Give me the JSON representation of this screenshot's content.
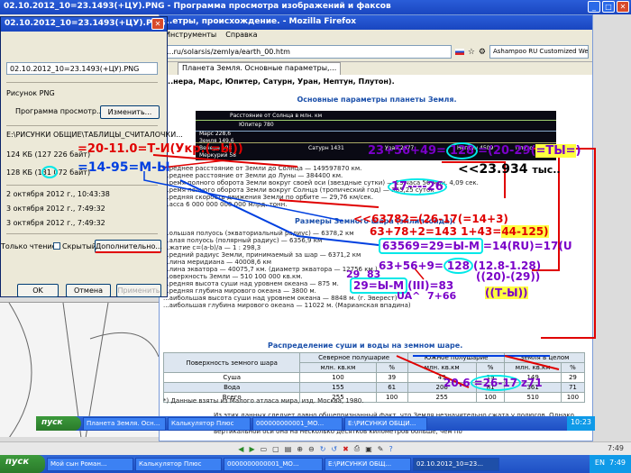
{
  "viewer": {
    "title": "02.10.2012_10=23.1493(+ЦУ).PNG - Программа просмотра изображений и факсов",
    "bottom_time": "7:49",
    "toolbar_icons": [
      "prev-icon",
      "next-icon",
      "fit-icon",
      "actual-size-icon",
      "slideshow-icon",
      "zoom-in-icon",
      "zoom-out-icon",
      "rotate-cw-icon",
      "rotate-ccw-icon",
      "delete-icon",
      "print-icon",
      "save-icon",
      "edit-icon",
      "help-icon"
    ]
  },
  "firefox": {
    "title": "...етры, происхождение. - Mozilla Firefox",
    "menu": [
      "Инструменты",
      "Справка"
    ],
    "url": "...ru/solarsis/zemlya/earth_00.htm",
    "search_placeholder": "Ashampoo RU Customized Web",
    "tab_label": "Планета Земля. Основные параметры,...",
    "page_heading": "...нера, Марс, Юпитер, Сатурн, Уран, Нептун, Плутон).",
    "section1_title": "Основные параметры планеты Земля.",
    "solar_labels": {
      "asteroids": "Расстояние от Солнца в млн. км",
      "jupiter": "Юпитер 780",
      "mars": "Марс 228,6",
      "earth": "Земля 149,6",
      "venus": "Венера 108",
      "mercury": "Меркурий 58",
      "saturn": "Сатурн 1431",
      "uranus": "Уран 2877",
      "neptune": "Нептун 4509",
      "pluto": "Плутон 5916"
    },
    "params": [
      "...реднее расстояние от Земли до Солнца — 149597870 км.",
      "...реднее расстояние от Земли до Луны — 384400 км.",
      "...ремя полного оборота Земли вокруг своей оси (звездные сутки) — 23 часа 56 мин. 4,09 сек.",
      "...ремя полного оборота Земли вокруг Солнца (тропический год) — 365,25 суток",
      "...редняя скорость движения Земли по орбите — 29,76 км/сек.",
      "...асса 6 000 000 000 000 млрд. тонн."
    ],
    "section2_title": "Размеры Земного шара (эллипсоида):",
    "sizes": [
      "...ольшая полуось (экваториальный радиус) — 6378,2 км",
      "...алая полуось (полярный радиус) — 6356,9 км",
      "...жатие c=(a-b)/a — 1 : 298,3",
      "...редний радиус Земли, принимаемый за шар — 6371,2 км",
      "...лина меридиана — 40008,6 км",
      "...лина экватора — 40075,7 км. (диаметр экватора — 12756 км.)",
      "...оверхность Земли — 510 100 000 кв.км.",
      "...редняя высота суши над уровнем океана — 875 м.",
      "...редняя глубина мирового океана — 3800 м.",
      "...аибольшая высота суши над уровнем океана — 8848 м. (г. Эверест)",
      "...аибольшая глубина мирового океана — 11022 м. (Марианская впадина)"
    ],
    "section3_title": "Распределение суши и воды на земном шаре.",
    "table": {
      "h_surface": "Поверхность земного шара",
      "h_north": "Северное полушарие",
      "h_south": "Южное полушарие",
      "h_earth": "Земля в целом",
      "h_unit": "млн. кв.км",
      "h_pct": "%",
      "rows": [
        {
          "name": "Суша",
          "n": "100",
          "np": "39",
          "s": "49",
          "sp": "19",
          "e": "149",
          "ep": "29"
        },
        {
          "name": "Вода",
          "n": "155",
          "np": "61",
          "s": "206",
          "sp": "81",
          "e": "361",
          "ep": "71"
        },
        {
          "name": "Всего",
          "n": "255",
          "np": "100",
          "s": "255",
          "sp": "100",
          "e": "510",
          "ep": "100"
        }
      ]
    },
    "footnote": "*) Данные взяты из Малого атласа мира, изд. Москва, 1980.",
    "para": "Из этих данных следует давно общепризнанный факт, что Земля незначительно сжата у полюсов. Однако имеется данные о том, что Земля имеет дынеобразную форму, т.е. сжата на экваторе так, что по вертикальной оси она на несколько десятков километров больше, чем по"
  },
  "dialog": {
    "title": "02.10.2012_10=23.1493(+ЦУ).PNG",
    "filename": "02.10.2012_10=23.1493(+ЦУ).PNG",
    "type_label": "Рисунок PNG",
    "program_label": "Программа просмотр...",
    "change_button": "Изменить...",
    "path": "E:\\РИСУНКИ ОБЩИЕ\\ТАБЛИЦЫ_СЧИТАЛОЧКИ...",
    "size1": "124 КБ (127 226 байт)",
    "size2": "128 КБ (131 072 байт)",
    "date1": "2 октября 2012 г., 10:43:38",
    "date2": "3 октября 2012 г., 7:49:32",
    "date3": "3 октября 2012 г., 7:49:32",
    "readonly_label": "Только чтение",
    "hidden_label": "Скрытый",
    "advanced_button": "Дополнительно...",
    "ok_button": "OK",
    "cancel_button": "Отмена",
    "apply_button": "Применить"
  },
  "annotations": {
    "a1": "=20-11.0=Т-И(Укр.(=Ы))",
    "a2": "=14-95=М-Ы",
    "a3": "23+56+49=",
    "a3b": "128",
    "a3c": "=(20-29(",
    "a3d": "=ТЫ=",
    "a3e": ")",
    "a4": "<<23.934",
    "a4b": "тыс..",
    "a5": "17----26",
    "a6": "<<63782=(26-17(=14+3)",
    "a7": "63+78+2=143",
    "a7b": "1+43=",
    "a7c": "44-125)",
    "a8": "63569=29=Ы-М",
    "a8b": "=14(RU)=17(U",
    "a9": "63+56+9=",
    "a9b": "128",
    "a9c": "(12.8-1.28)",
    "a10": "29",
    "a10b": "83",
    "a11": "29=Ы-М",
    "a11b": "(III)=83",
    "a12": "((20)-(29))",
    "a13": "((Т-Ы))",
    "a14": "UA^",
    "a14b": "7+66",
    "a15": "20.6",
    "a15b": "=26-17",
    "a15c": "z71"
  },
  "taskbar_inner": {
    "start": "пуск",
    "items": [
      "Планета Земля. Осн...",
      "Калькулятор Плюс",
      "000000000001_МО...",
      "E:\\РИСУНКИ ОБЩИ..."
    ],
    "clock": "10:23"
  },
  "taskbar": {
    "start": "пуск",
    "items": [
      "Мой сын Роман...",
      "Калькулятор Плюс",
      "0000000000001_МО...",
      "E:\\РИСУНКИ ОБЩ...",
      "02.10.2012_10=23..."
    ],
    "lang": "EN",
    "clock": "7:49"
  }
}
